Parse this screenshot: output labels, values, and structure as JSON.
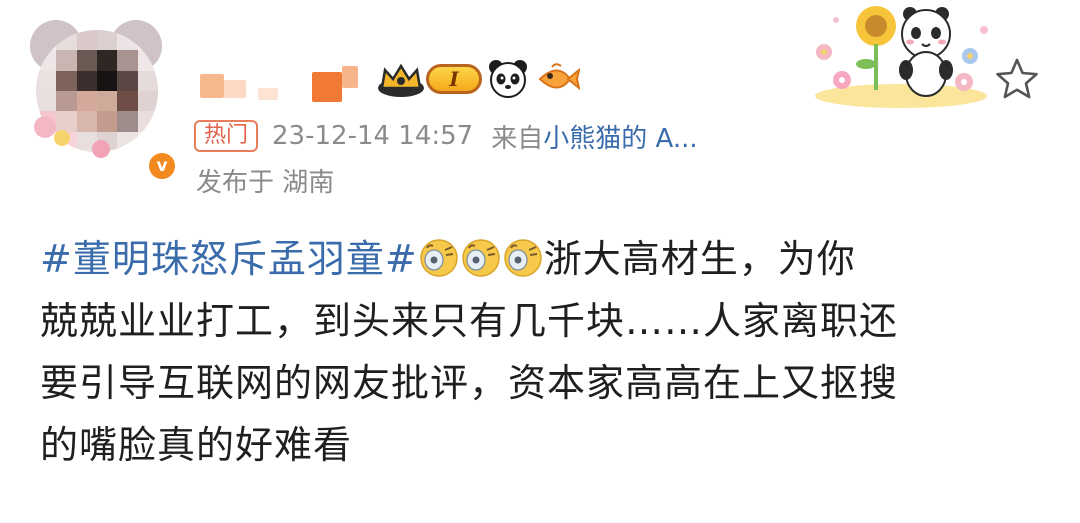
{
  "author": {
    "avatar_icon": "avatar-icon",
    "verified_icon": "verified-badge-icon",
    "verified_glyph": "v",
    "name_obscured": true,
    "badges": [
      {
        "icon": "crown-member-icon"
      },
      {
        "icon": "level-badge-icon",
        "label": "I"
      },
      {
        "icon": "panda-emoji-icon"
      },
      {
        "icon": "goldfish-emoji-icon"
      }
    ]
  },
  "meta": {
    "hot_tag": "热门",
    "timestamp": "23-12-14 14:57",
    "from_prefix": "来自",
    "source": "小熊猫的 A...",
    "location": "发布于 湖南"
  },
  "actions": {
    "star_icon": "star-outline-icon"
  },
  "decoration": {
    "icon": "panda-sunflower-sticker-icon"
  },
  "post": {
    "hashtag": "#董明珠怒斥孟羽童#",
    "emoji_icon": "doge-sweat-emoji-icon",
    "emoji_count": 3,
    "line1_text": "浙大高材生，为你",
    "line2": "兢兢业业打工，到头来只有几千块……人家离职还",
    "line3": "要引导互联网的网友批评，资本家高高在上又抠搜",
    "line4": "的嘴脸真的好难看"
  },
  "colors": {
    "link_blue": "#3a6bab",
    "meta_gray": "#8b8b8b",
    "hot_tag": "#e3624a",
    "verified_orange": "#f28a20",
    "body_text": "#1f1f1f"
  }
}
